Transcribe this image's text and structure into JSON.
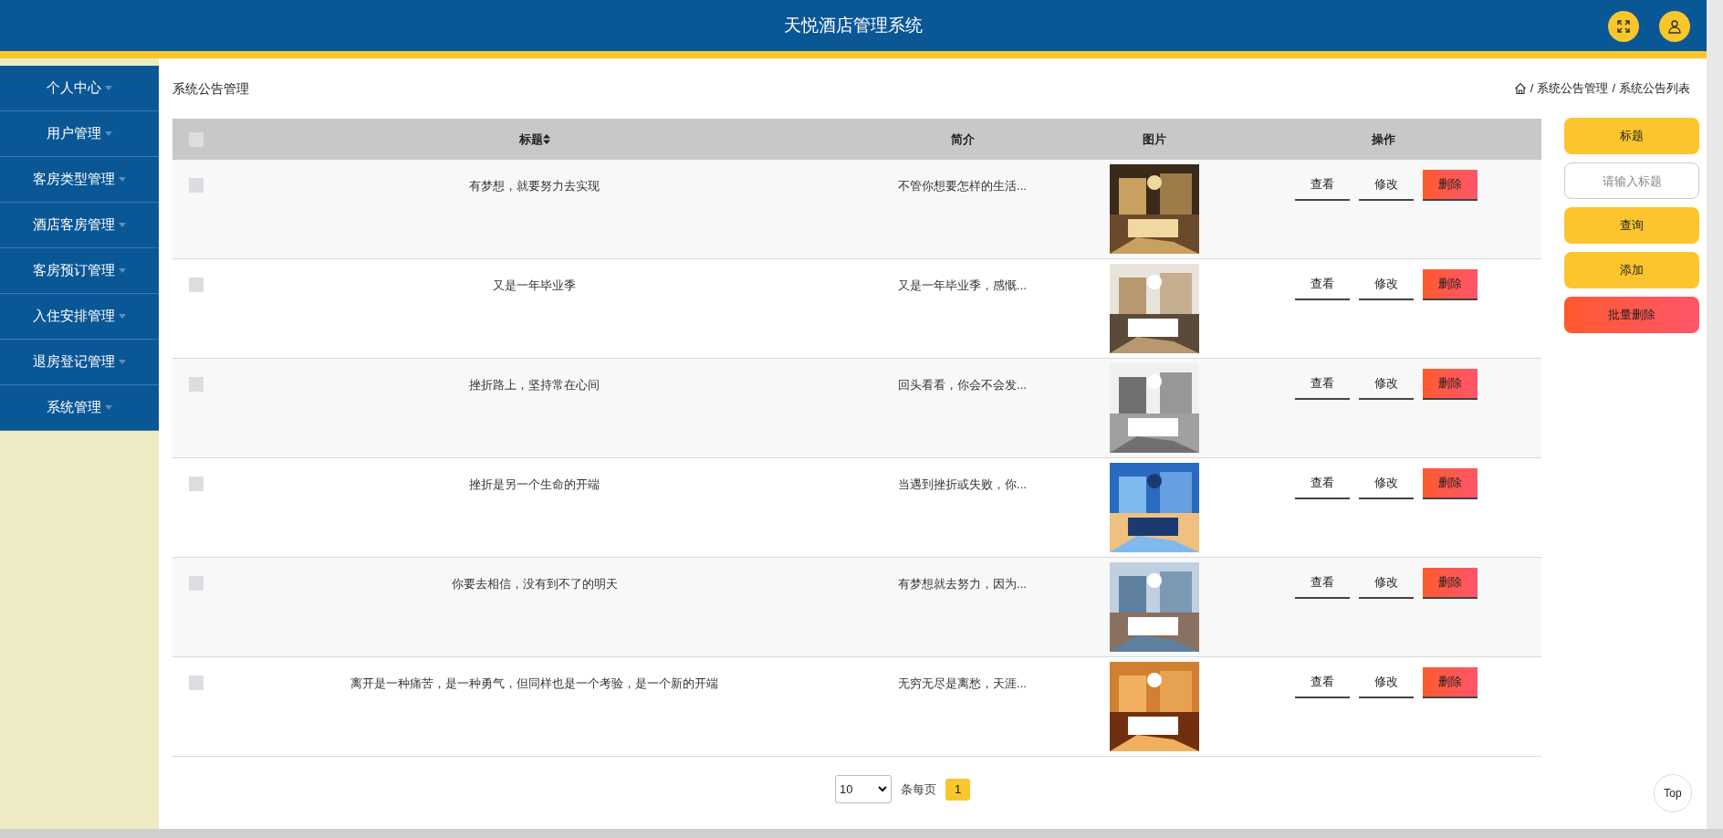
{
  "header": {
    "title": "天悦酒店管理系统"
  },
  "sidebar": {
    "items": [
      {
        "label": "个人中心",
        "expandable": true
      },
      {
        "label": "用户管理",
        "expandable": true
      },
      {
        "label": "客房类型管理",
        "expandable": true
      },
      {
        "label": "酒店客房管理",
        "expandable": true
      },
      {
        "label": "客房预订管理",
        "expandable": true
      },
      {
        "label": "入住安排管理",
        "expandable": true
      },
      {
        "label": "退房登记管理",
        "expandable": true
      },
      {
        "label": "系统管理",
        "expandable": true
      }
    ]
  },
  "page_title": "系统公告管理",
  "breadcrumb": [
    {
      "separator": "/",
      "label": "系统公告管理"
    },
    {
      "separator": "/",
      "label": "系统公告列表"
    }
  ],
  "table": {
    "columns": [
      {
        "kind": "checkbox",
        "checked": false
      },
      {
        "kind": "text",
        "label": "标题",
        "sortable": true
      },
      {
        "kind": "text",
        "label": "简介",
        "sortable": false
      },
      {
        "kind": "text",
        "label": "图片",
        "sortable": false
      },
      {
        "kind": "text",
        "label": "操作",
        "sortable": false
      }
    ],
    "rows": [
      {
        "checked": false,
        "title": "有梦想，就要努力去实现",
        "intro": "不管你想要怎样的生活...",
        "actions": [
          {
            "kind": "view",
            "label": "查看"
          },
          {
            "kind": "edit",
            "label": "修改"
          },
          {
            "kind": "delete",
            "label": "删除"
          }
        ]
      },
      {
        "checked": false,
        "title": "又是一年毕业季",
        "intro": "又是一年毕业季，感慨...",
        "actions": [
          {
            "kind": "view",
            "label": "查看"
          },
          {
            "kind": "edit",
            "label": "修改"
          },
          {
            "kind": "delete",
            "label": "删除"
          }
        ]
      },
      {
        "checked": false,
        "title": "挫折路上，坚持常在心间",
        "intro": "回头看看，你会不会发...",
        "actions": [
          {
            "kind": "view",
            "label": "查看"
          },
          {
            "kind": "edit",
            "label": "修改"
          },
          {
            "kind": "delete",
            "label": "删除"
          }
        ]
      },
      {
        "checked": false,
        "title": "挫折是另一个生命的开端",
        "intro": "当遇到挫折或失败，你...",
        "actions": [
          {
            "kind": "view",
            "label": "查看"
          },
          {
            "kind": "edit",
            "label": "修改"
          },
          {
            "kind": "delete",
            "label": "删除"
          }
        ]
      },
      {
        "checked": false,
        "title": "你要去相信，没有到不了的明天",
        "intro": "有梦想就去努力，因为...",
        "actions": [
          {
            "kind": "view",
            "label": "查看"
          },
          {
            "kind": "edit",
            "label": "修改"
          },
          {
            "kind": "delete",
            "label": "删除"
          }
        ]
      },
      {
        "checked": false,
        "title": "离开是一种痛苦，是一种勇气，但同样也是一个考验，是一个新的开端",
        "intro": "无穷无尽是离愁，天涯...",
        "actions": [
          {
            "kind": "view",
            "label": "查看"
          },
          {
            "kind": "edit",
            "label": "修改"
          },
          {
            "kind": "delete",
            "label": "删除"
          }
        ]
      }
    ]
  },
  "search_panel": {
    "field_label": "标题",
    "placeholder": "请输入标题",
    "buttons": [
      {
        "kind": "primary",
        "label": "查询"
      },
      {
        "kind": "primary",
        "label": "添加"
      },
      {
        "kind": "danger",
        "label": "批量删除"
      }
    ]
  },
  "pagination": {
    "page_size": "10",
    "per_page_label": "条每页",
    "pages": [
      {
        "label": "1",
        "selected": true
      }
    ]
  },
  "top_button": "Top"
}
